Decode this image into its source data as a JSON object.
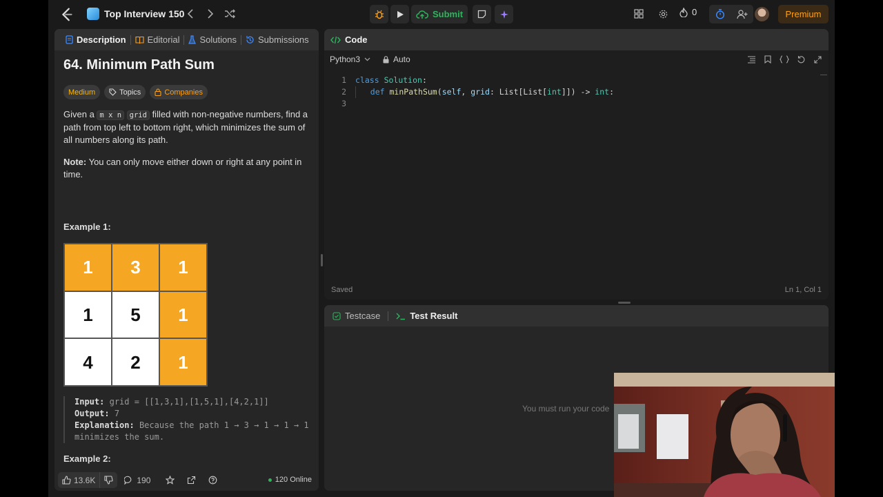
{
  "topbar": {
    "problem_list_title": "Top Interview 150",
    "submit_label": "Submit",
    "streak_count": "0",
    "premium_label": "Premium",
    "accent_color": "#ffa116",
    "submit_color": "#2db55d"
  },
  "description_panel": {
    "tabs": [
      {
        "label": "Description",
        "icon": "description-icon"
      },
      {
        "label": "Editorial",
        "icon": "editorial-icon"
      },
      {
        "label": "Solutions",
        "icon": "solutions-icon"
      },
      {
        "label": "Submissions",
        "icon": "submissions-icon"
      }
    ],
    "title": "64. Minimum Path Sum",
    "tags": {
      "difficulty": "Medium",
      "topics": "Topics",
      "companies": "Companies"
    },
    "desc": {
      "p1_before": "Given a ",
      "code_mxn": "m x n",
      "code_grid": "grid",
      "p1_after": " filled with non-negative numbers, find a path from top left to bottom right, which minimizes the sum of all numbers along its path.",
      "note_label": "Note:",
      "note_text": " You can only move either down or right at any point in time."
    },
    "example1": {
      "heading": "Example 1:",
      "grid": [
        [
          "1",
          "3",
          "1"
        ],
        [
          "1",
          "5",
          "1"
        ],
        [
          "4",
          "2",
          "1"
        ]
      ],
      "input_label": "Input:",
      "input_value": "grid = [[1,3,1],[1,5,1],[4,2,1]]",
      "output_label": "Output:",
      "output_value": "7",
      "explanation_label": "Explanation:",
      "explanation_value": "Because the path 1 → 3 → 1 → 1 → 1 minimizes the sum."
    },
    "example2": {
      "heading": "Example 2:"
    },
    "footer": {
      "likes": "13.6K",
      "comments": "190",
      "online": "120 Online"
    }
  },
  "code_panel": {
    "title": "Code",
    "language": "Python3",
    "mode": "Auto",
    "lines": [
      "1",
      "2",
      "3"
    ],
    "status": "Saved",
    "cursor": "Ln 1, Col 1"
  },
  "result_panel": {
    "tab_testcase": "Testcase",
    "tab_result": "Test Result",
    "message": "You must run your code"
  }
}
